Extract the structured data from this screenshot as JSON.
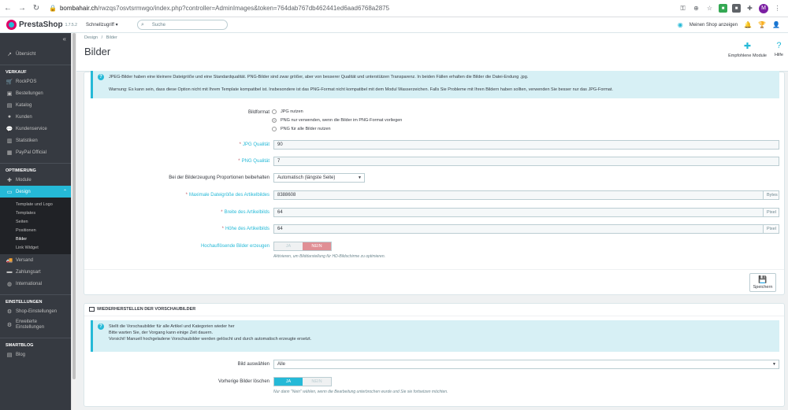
{
  "browser": {
    "url_host": "bombahair.ch",
    "url_rest": "/rwzqs7osvtsrmwgo/index.php?controller=AdminImages&token=764dab767db462441ed6aad6768a2875",
    "profile_initial": "M"
  },
  "topbar": {
    "logo": "PrestaShop",
    "version": "1.7.5.2",
    "quick_access": "Schnellzugriff ▾",
    "search_placeholder": "Suche",
    "show_shop": "Meinen Shop anzeigen"
  },
  "sidebar": {
    "overview": "Übersicht",
    "sections": [
      {
        "title": "VERKAUF",
        "items": [
          "RockPOS",
          "Bestellungen",
          "Katalog",
          "Kunden",
          "Kundenservice",
          "Statistiken",
          "PayPal Official"
        ]
      },
      {
        "title": "OPTIMIERUNG",
        "items": [
          "Module",
          "Design"
        ]
      },
      {
        "title": "EINSTELLUNGEN",
        "items": [
          "Shop-Einstellungen",
          "Erweiterte Einstellungen"
        ]
      },
      {
        "title": "SMARTBLOG",
        "items": [
          "Blog"
        ]
      }
    ],
    "design_sub": [
      "Template und Logo",
      "Templates",
      "Seiten",
      "Positionen",
      "Bilder",
      "Link Widget"
    ],
    "after_design": [
      "Versand",
      "Zahlungsart",
      "International"
    ]
  },
  "page": {
    "breadcrumb_parent": "Design",
    "breadcrumb_sep": "/",
    "breadcrumb_current": "Bilder",
    "title": "Bilder",
    "tool_modules": "Empfohlene Module",
    "tool_help": "Hilfe"
  },
  "panel1": {
    "info_line1": "JPEG-Bilder haben eine kleinere Dateigröße und eine Standardqualität. PNG-Bilder sind zwar größer, aber von besserer Qualität und unterstützen Transparenz. In beiden Fällen erhalten die Bilder die Datei-Endung .jpg.",
    "info_line2": "Warnung: Es kann sein, dass diese Option nicht mit Ihrem Template kompatibel ist. Insbesondere ist das PNG-Format nicht kompatibel mit dem Modul Wasserzeichen. Falls Sie Probleme mit Ihren Bildern haben sollten, verwenden Sie besser nur das JPG-Format.",
    "format_label": "Bildformat",
    "format_options": [
      "JPG nutzen",
      "PNG nur verwenden, wenn die Bilder im PNG-Format vorliegen",
      "PNG für alle Bilder nutzen"
    ],
    "format_selected_index": 1,
    "jpg_quality_label": "JPG Qualität",
    "jpg_quality_value": "90",
    "png_quality_label": "PNG Qualität",
    "png_quality_value": "7",
    "ratio_label": "Bei der Bilderzeugung Proportionen beibehalten",
    "ratio_value": "Automatisch (längste Seite)",
    "max_size_label": "Maximale Dateigröße des Artikelbildes",
    "max_size_value": "8388608",
    "max_size_unit": "Bytes",
    "width_label": "Breite des Artikelbilds",
    "width_value": "64",
    "width_unit": "Pixel",
    "height_label": "Höhe des Artikelbilds",
    "height_value": "64",
    "height_unit": "Pixel",
    "hires_label": "Hochauflösende Bilder erzeugen",
    "switch_yes": "JA",
    "switch_no": "NEIN",
    "hires_help": "Aktivieren, um Bilddarstellung für HD-Bildschirme zu optimieren.",
    "save": "Speichern"
  },
  "panel2": {
    "title": "WIEDERHERSTELLEN DER VORSCHAUBILDER",
    "info_line1": "Stellt die Vorschaubilder für alle Artikel und Kategorien wieder her",
    "info_line2": "Bitte warten Sie, der Vorgang kann einige Zeit dauern.",
    "info_line3": "Vorsicht! Manuell hochgeladene Vorschaubilder werden gelöscht und durch automatisch erzeugte ersetzt.",
    "select_label": "Bild auswählen",
    "select_value": "Alle",
    "delete_label": "Vorherige Bilder löschen",
    "switch_yes": "JA",
    "switch_no": "NEIN",
    "delete_help": "Nur dann \"Nein\" wählen, wenn die Bearbeitung unterbrochen wurde und Sie sie fortsetzen möchten."
  }
}
